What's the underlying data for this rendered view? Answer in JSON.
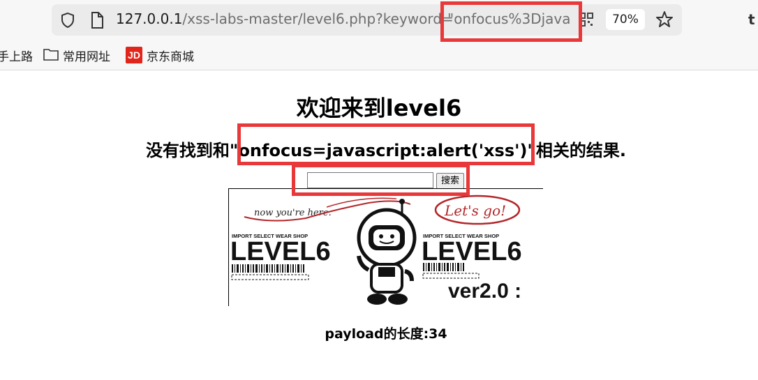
{
  "browser": {
    "url_main": "127.0.0.1",
    "url_path": "/xss-labs-master/level6.php?keyword=",
    "url_tail": "\"onfocus%3Djava",
    "zoom": "70%",
    "edge_glyph": "t"
  },
  "bookmarks": {
    "item1": "手上路",
    "item2": "常用网址",
    "item3": "京东商城",
    "jd_logo": "JD"
  },
  "page": {
    "title": "欢迎来到level6",
    "result_text": "没有找到和\"onfocus=javascript:alert('xss')\"相关的结果.",
    "search_value": "",
    "search_button": "搜索",
    "payload_text": "payload的长度:34"
  },
  "banner": {
    "now_text": "now you're here.",
    "lets_go": "Let's go!",
    "shop_left": "IMPORT SELECT WEAR SHOP",
    "shop_right": "IMPORT SELECT WEAR SHOP",
    "level_left": "LEVEL6",
    "level_right": "LEVEL6",
    "version": "ver2.0 :"
  },
  "colors": {
    "highlight": "#e8383a",
    "jd_red": "#e1251b"
  }
}
